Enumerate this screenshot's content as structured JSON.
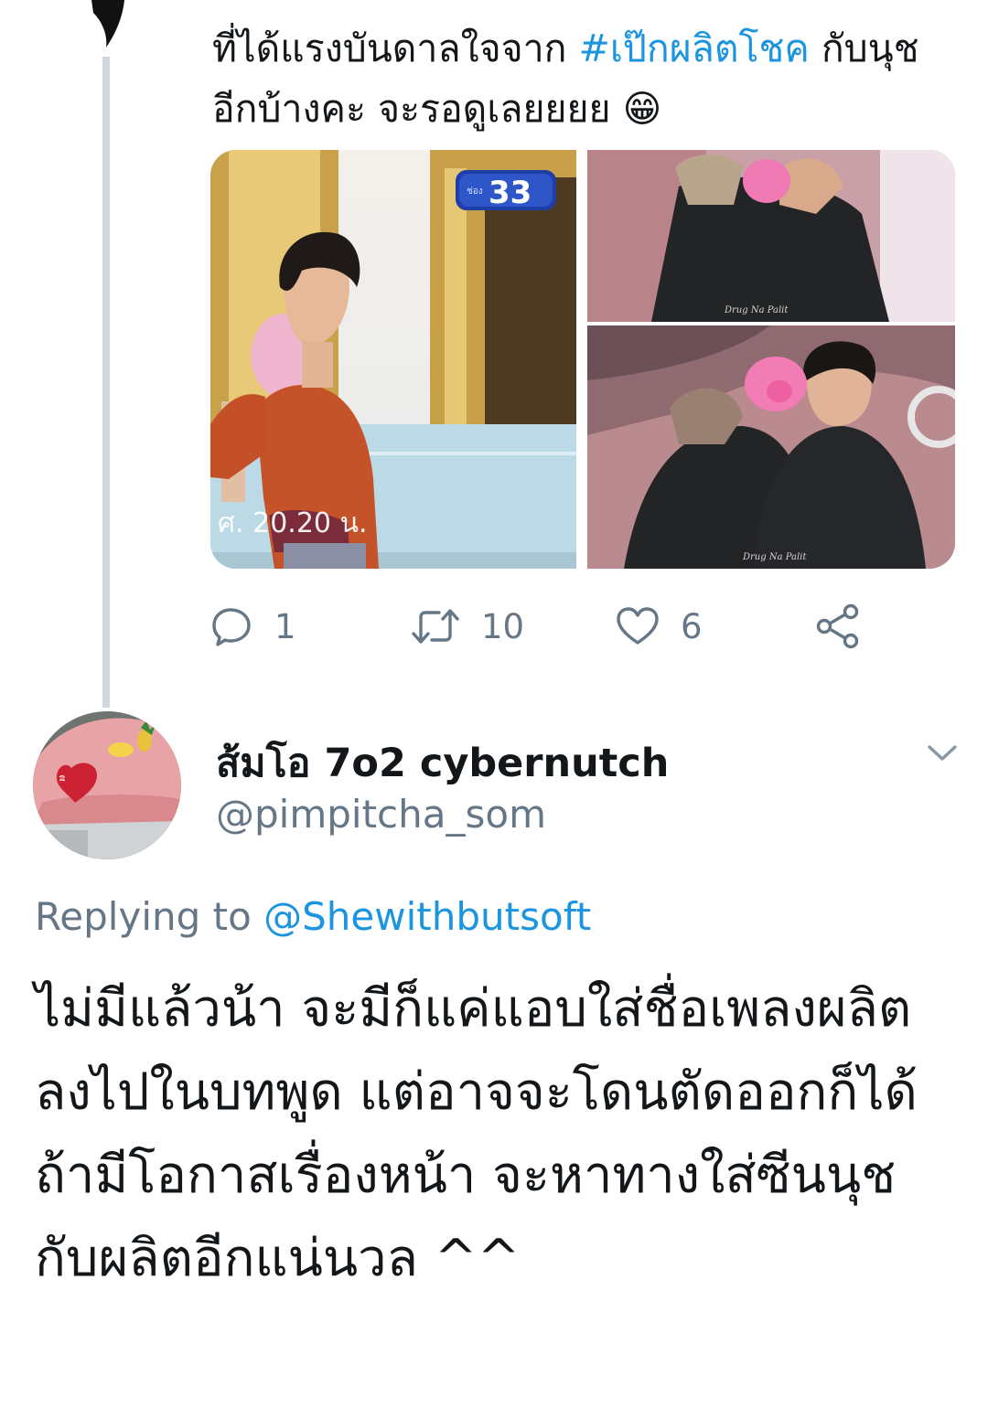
{
  "thread": {
    "text_before": "ที่ได้แรงบันดาลใจจาก ",
    "hashtag": "#เป๊กผลิตโชค",
    "text_after": " กับนุชอีกบ้างคะ จะรอดูเลยยยย 😁",
    "media": {
      "channel_badge": "33",
      "channel_small": "ช่อง",
      "airtime": "ศ. 20.20 น.",
      "watermark": "Drug Na Palit"
    },
    "actions": {
      "reply_count": "1",
      "retweet_count": "10",
      "like_count": "6"
    }
  },
  "reply_tweet": {
    "display_name": "ส้มโอ 7o2 cybernutch",
    "handle": "@pimpitcha_som",
    "replying_prefix": "Replying to ",
    "replying_mention": "@Shewithbutsoft",
    "text": "ไม่มีแล้วน้า จะมีก็แค่แอบใส่ชื่อเพลงผลิตลงไปในบทพูด แต่อาจจะโดนตัดออกก็ได้ ถ้ามีโอกาสเรื่องหน้า จะหาทางใส่ซีนนุชกับผลิตอีกแน่นวล ^^"
  },
  "colors": {
    "text": "#14171a",
    "secondary": "#657786",
    "link": "#1b95e0",
    "thread_line": "#cfd9de"
  }
}
